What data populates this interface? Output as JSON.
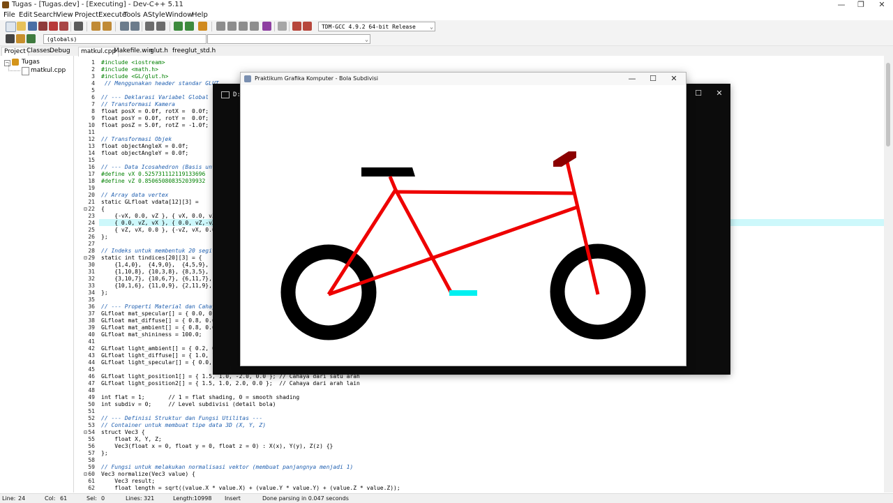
{
  "window": {
    "title": "Tugas - [Tugas.dev] - [Executing] - Dev-C++ 5.11",
    "controls": {
      "minimize": "—",
      "restore": "❐",
      "close": "✕"
    }
  },
  "menu": [
    "File",
    "Edit",
    "Search",
    "View",
    "Project",
    "Execute",
    "Tools",
    "AStyle",
    "Window",
    "Help"
  ],
  "toolbar": {
    "compiler": "TDM-GCC 4.9.2 64-bit Release",
    "scope": "(globals)",
    "dropdown_arrow": "⌄"
  },
  "left_panel": {
    "tabs": [
      "Project",
      "Classes",
      "Debug"
    ],
    "tree": {
      "project": "Tugas",
      "file": "matkul.cpp",
      "toggle": "−"
    }
  },
  "editor": {
    "tabs": [
      "matkul.cpp",
      "Makefile.win",
      "glut.h",
      "freeglut_std.h"
    ],
    "highlight_line": 24,
    "lines": [
      {
        "n": "1",
        "t": "#include <iostream>",
        "c": "pp"
      },
      {
        "n": "2",
        "t": "#include <math.h>",
        "c": "pp"
      },
      {
        "n": "3",
        "t": "#include <GL/glut.h>",
        "c": "pp"
      },
      {
        "n": "4",
        "t": " // Menggunakan header standar GLUT",
        "c": "cmt"
      },
      {
        "n": "5",
        "t": "",
        "c": ""
      },
      {
        "n": "6",
        "t": "// --- Deklarasi Variabel Global --------------------------------",
        "c": "cmt"
      },
      {
        "n": "7",
        "t": "// Transformasi Kamera",
        "c": "cmt"
      },
      {
        "n": "8",
        "t": "float posX = 0.0f, rotX =  0.0f;",
        "c": ""
      },
      {
        "n": "9",
        "t": "float posY = 0.0f, rotY =  0.0f;",
        "c": ""
      },
      {
        "n": "10",
        "t": "float posZ = 5.0f, rotZ = -1.0f;",
        "c": ""
      },
      {
        "n": "11",
        "t": "",
        "c": ""
      },
      {
        "n": "12",
        "t": "// Transformasi Objek",
        "c": "cmt"
      },
      {
        "n": "13",
        "t": "float objectAngleX = 0.0f;",
        "c": ""
      },
      {
        "n": "14",
        "t": "float objectAngleY = 0.0f;",
        "c": ""
      },
      {
        "n": "15",
        "t": "",
        "c": ""
      },
      {
        "n": "16",
        "t": "// --- Data Icosahedron (Basis untuk subdivisi) ---",
        "c": "cmt"
      },
      {
        "n": "17",
        "t": "#define vX 0.525731112119133696",
        "c": "pp"
      },
      {
        "n": "18",
        "t": "#define vZ 0.850650808352039932",
        "c": "pp"
      },
      {
        "n": "19",
        "t": "",
        "c": ""
      },
      {
        "n": "20",
        "t": "// Array data vertex",
        "c": "cmt"
      },
      {
        "n": "21",
        "t": "static GLfloat vdata[12][3] =",
        "c": ""
      },
      {
        "n": "22",
        "t": "{",
        "c": ""
      },
      {
        "n": "23",
        "t": "    {-vX, 0.0, vZ }, { vX, 0.0, vZ },",
        "c": ""
      },
      {
        "n": "24",
        "t": "    { 0.0, vZ, vX }, { 0.0, vZ,-vX },",
        "c": ""
      },
      {
        "n": "25",
        "t": "    { vZ, vX, 0.0 }, {-vZ, vX, 0.0 },",
        "c": ""
      },
      {
        "n": "26",
        "t": "};",
        "c": ""
      },
      {
        "n": "27",
        "t": "",
        "c": ""
      },
      {
        "n": "28",
        "t": "// Indeks untuk membentuk 20 segitiga",
        "c": "cmt"
      },
      {
        "n": "29",
        "t": "static int tindices[20][3] = {",
        "c": ""
      },
      {
        "n": "30",
        "t": "    {1,4,0},  {4,9,0},  {4,5,9},",
        "c": ""
      },
      {
        "n": "31",
        "t": "    {1,10,8}, {10,3,8}, {8,3,5},",
        "c": ""
      },
      {
        "n": "32",
        "t": "    {3,10,7}, {10,6,7}, {6,11,7},",
        "c": ""
      },
      {
        "n": "33",
        "t": "    {10,1,6}, {11,0,9}, {2,11,9},",
        "c": ""
      },
      {
        "n": "34",
        "t": "};",
        "c": ""
      },
      {
        "n": "35",
        "t": "",
        "c": ""
      },
      {
        "n": "36",
        "t": "// --- Properti Material dan Cahaya ---",
        "c": "cmt"
      },
      {
        "n": "37",
        "t": "GLfloat mat_specular[] = { 0.0, 0.0,",
        "c": ""
      },
      {
        "n": "38",
        "t": "GLfloat mat_diffuse[] = { 0.8, 0.6,",
        "c": ""
      },
      {
        "n": "39",
        "t": "GLfloat mat_ambient[] = { 0.8, 0.6,",
        "c": ""
      },
      {
        "n": "40",
        "t": "GLfloat mat_shininess = 100.0;",
        "c": ""
      },
      {
        "n": "41",
        "t": "",
        "c": ""
      },
      {
        "n": "42",
        "t": "GLfloat light_ambient[] = { 0.2, 0.",
        "c": ""
      },
      {
        "n": "43",
        "t": "GLfloat light_diffuse[] = { 1.0, 1.",
        "c": ""
      },
      {
        "n": "44",
        "t": "GLfloat light_specular[] = { 0.0,",
        "c": ""
      },
      {
        "n": "45",
        "t": "",
        "c": ""
      },
      {
        "n": "46",
        "t": "GLfloat light_position1[] = { 1.5, 1.0, -2.0, 0.0 }; // Cahaya dari satu arah",
        "c": ""
      },
      {
        "n": "47",
        "t": "GLfloat light_position2[] = { 1.5, 1.0, 2.0, 0.0 };  // Cahaya dari arah lain",
        "c": ""
      },
      {
        "n": "48",
        "t": "",
        "c": ""
      },
      {
        "n": "49",
        "t": "int flat = 1;       // 1 = flat shading, 0 = smooth shading",
        "c": ""
      },
      {
        "n": "50",
        "t": "int subdiv = 0;     // Level subdivisi (detail bola)",
        "c": ""
      },
      {
        "n": "51",
        "t": "",
        "c": ""
      },
      {
        "n": "52",
        "t": "// --- Definisi Struktur dan Fungsi Utilitas ---",
        "c": "cmt"
      },
      {
        "n": "53",
        "t": "// Container untuk membuat tipe data 3D (X, Y, Z)",
        "c": "cmt"
      },
      {
        "n": "54",
        "t": "struct Vec3 {",
        "c": ""
      },
      {
        "n": "55",
        "t": "    float X, Y, Z;",
        "c": ""
      },
      {
        "n": "56",
        "t": "    Vec3(float x = 0, float y = 0, float z = 0) : X(x), Y(y), Z(z) {}",
        "c": ""
      },
      {
        "n": "57",
        "t": "};",
        "c": ""
      },
      {
        "n": "58",
        "t": "",
        "c": ""
      },
      {
        "n": "59",
        "t": "// Fungsi untuk melakukan normalisasi vektor (membuat panjangnya menjadi 1)",
        "c": "cmt"
      },
      {
        "n": "60",
        "t": "Vec3 normalize(Vec3 value) {",
        "c": ""
      },
      {
        "n": "61",
        "t": "    Vec3 result;",
        "c": ""
      },
      {
        "n": "62",
        "t": "    float length = sqrt((value.X * value.X) + (value.Y * value.Y) + (value.Z * value.Z));",
        "c": ""
      }
    ]
  },
  "console": {
    "title": "D:\\",
    "controls": {
      "maximize": "☐",
      "close": "✕"
    }
  },
  "glut": {
    "title": "Praktikum Grafika Komputer - Bola Subdivisi",
    "controls": {
      "minimize": "—",
      "maximize": "☐",
      "close": "✕"
    }
  },
  "colors": {
    "frame": "#ee0000",
    "wheel": "#000000",
    "seat": "#000000",
    "pedal": "#00f0f0",
    "handlebar": "#8b0000",
    "highlight_line": "#cdf8fb"
  },
  "status": {
    "line": "Line:",
    "line_val": "24",
    "col": "Col:",
    "col_val": "61",
    "sel": "Sel:",
    "sel_val": "0",
    "lines": "Lines:",
    "lines_val": "321",
    "length": "Length:",
    "length_val": "10998",
    "mode": "Insert",
    "message": "Done parsing in 0.047 seconds"
  }
}
